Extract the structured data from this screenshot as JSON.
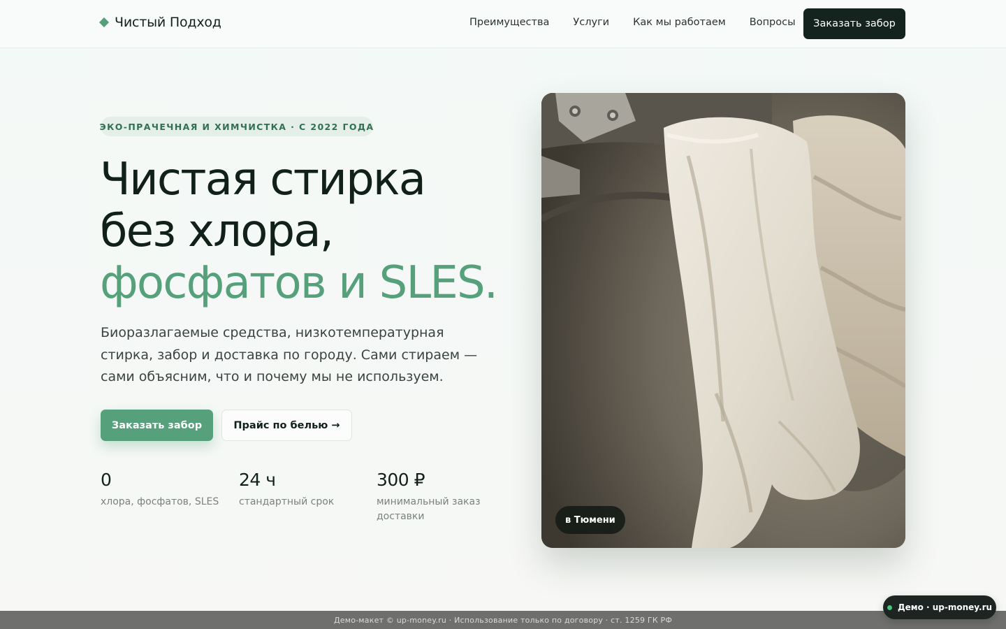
{
  "header": {
    "logo": "Чистый Подход",
    "nav": [
      "Преимущества",
      "Услуги",
      "Как мы работаем",
      "Вопросы"
    ],
    "cta": "Заказать забор"
  },
  "hero": {
    "badge": "ЭКО-ПРАЧЕЧНАЯ И ХИМЧИСТКА · С 2022 ГОДА",
    "headline_line1": "Чистая стирка",
    "headline_line2": "без хлора,",
    "headline_accent": "фосфатов и SLES.",
    "lead": "Биоразлагаемые средства, низкотемпературная стирка, забор и доставка по городу. Сами стираем — сами объясним, что и почему мы не используем.",
    "primary_button": "Заказать забор",
    "secondary_button": "Прайс по белью →",
    "stats": [
      {
        "value": "0",
        "label": "хлора, фосфатов, SLES"
      },
      {
        "value": "24 ч",
        "label": "стандартный срок"
      },
      {
        "value": "300 ₽",
        "label": "минимальный заказ доставки"
      }
    ],
    "photo_chip": "в Тюмени"
  },
  "footer": {
    "notice": "Демо-макет © up-money.ru · Использование только по договору · ст. 1259 ГК РФ",
    "demo_pill": "Демо · up-money.ru"
  },
  "colors": {
    "accent": "#56a07c",
    "dark": "#14231d",
    "badge_bg": "#e4efe9"
  },
  "icons": {
    "logo": "diamond-icon",
    "demo_status": "status-dot-icon"
  }
}
